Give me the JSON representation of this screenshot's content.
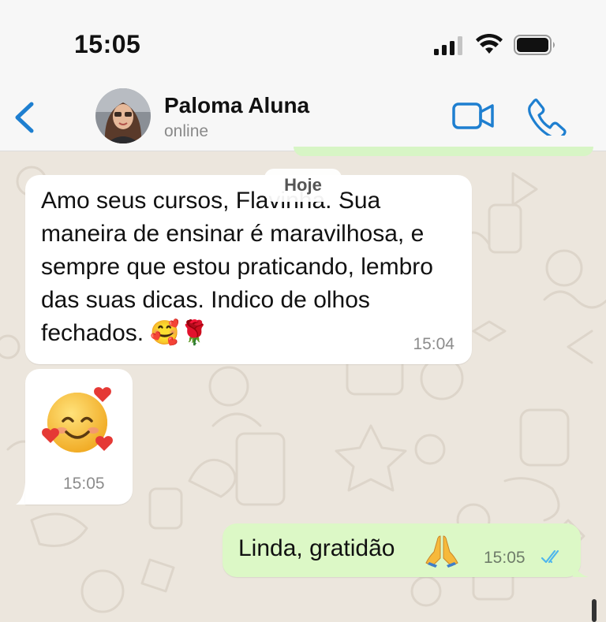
{
  "status_bar": {
    "time": "15:05",
    "icons": [
      "signal-icon",
      "wifi-icon",
      "battery-icon"
    ]
  },
  "header": {
    "back_icon": "chevron-left-icon",
    "contact_name": "Paloma Aluna",
    "contact_status": "online",
    "actions": [
      "video-call-icon",
      "phone-icon"
    ],
    "accent_color": "#1e7fd0"
  },
  "chat": {
    "date_chip": "Hoje",
    "messages": [
      {
        "direction": "incoming",
        "text": "Amo seus cursos, Flavinha. Sua maneira de ensinar é maravilhosa, e sempre que estou praticando, lembro das suas dicas. Indico de olhos fechados. 🥰🌹",
        "time": "15:04"
      },
      {
        "direction": "incoming",
        "emoji": "🥰",
        "time": "15:05"
      },
      {
        "direction": "outgoing",
        "text": "Linda, gratidão",
        "emoji": "🙏",
        "time": "15:05",
        "status": "read",
        "status_icon": "double-check-icon"
      }
    ]
  },
  "colors": {
    "incoming_bubble": "#ffffff",
    "outgoing_bubble": "#dcf8c6",
    "wallpaper": "#ece6dd",
    "read_receipt": "#4fb6ec"
  }
}
